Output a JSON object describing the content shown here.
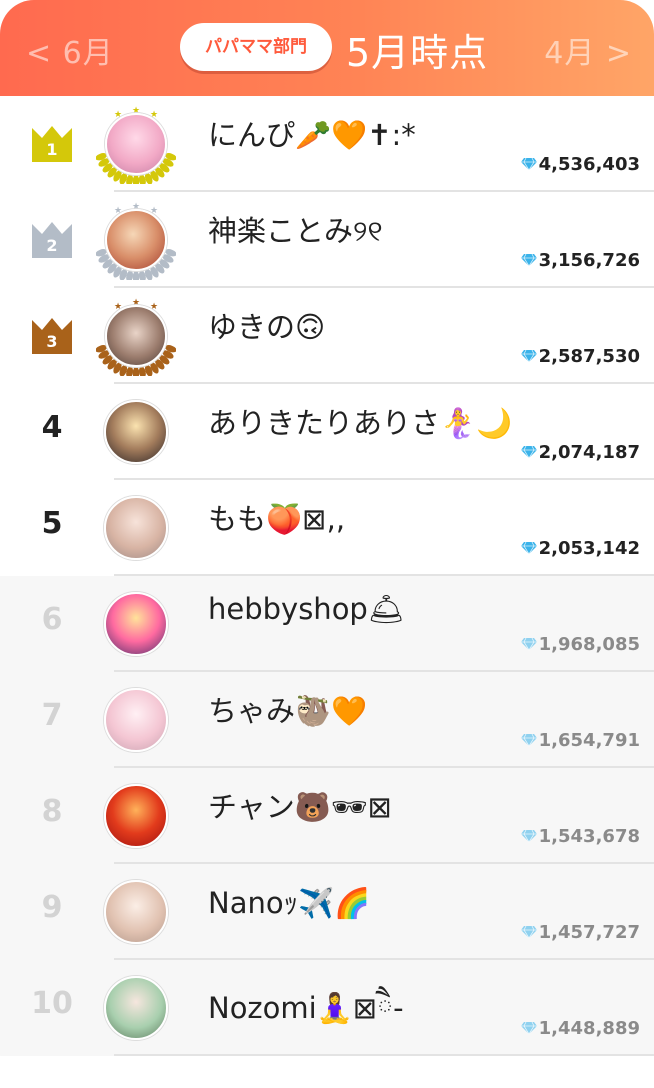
{
  "header": {
    "prev_label": "< 6月",
    "next_label": "4月 >",
    "category_badge": "パパママ部門",
    "title": "5月時点"
  },
  "colors": {
    "header_gradient_start": "#ff6a4f",
    "header_gradient_end": "#ffa567",
    "gold": "#d4c80a",
    "silver": "#b3bcc7",
    "bronze": "#a9621a",
    "diamond": "#3ab3ea"
  },
  "icons": {
    "point_icon": "diamond-icon",
    "top_rank_icon": "crown-icon"
  },
  "ranking": [
    {
      "rank": "1",
      "name": "にんぴ🥕🧡✝︎:*",
      "points": "4,536,403",
      "medal": "gold"
    },
    {
      "rank": "2",
      "name": "神楽ことみ୨୧",
      "points": "3,156,726",
      "medal": "silver"
    },
    {
      "rank": "3",
      "name": "ゆきの🙃",
      "points": "2,587,530",
      "medal": "bronze"
    },
    {
      "rank": "4",
      "name": "ありきたりありさ🧜‍♀️🌙",
      "points": "2,074,187",
      "medal": ""
    },
    {
      "rank": "5",
      "name": "もも🍑⊠‚‚",
      "points": "2,053,142",
      "medal": ""
    },
    {
      "rank": "6",
      "name": "hebbyshop🛎",
      "points": "1,968,085",
      "medal": ""
    },
    {
      "rank": "7",
      "name": "ちゃみ🦥🧡",
      "points": "1,654,791",
      "medal": ""
    },
    {
      "rank": "8",
      "name": "チャン🐻🕶⊠",
      "points": "1,543,678",
      "medal": ""
    },
    {
      "rank": "9",
      "name": "Nanoｯ✈️🌈",
      "points": "1,457,727",
      "medal": ""
    },
    {
      "rank": "10",
      "name": "Nozomi🧘‍♀️⊠ཻ‐",
      "points": "1,448,889",
      "medal": ""
    }
  ]
}
